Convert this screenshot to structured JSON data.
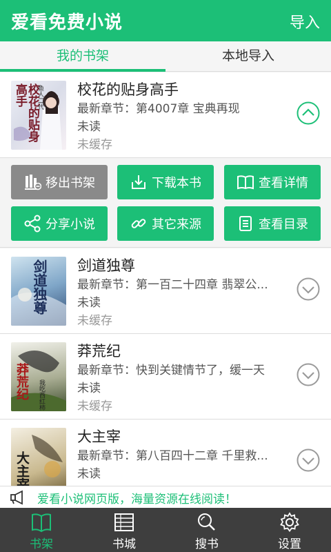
{
  "header": {
    "title": "爱看免费小说",
    "action_label": "导入"
  },
  "tabs": [
    {
      "label": "我的书架",
      "active": true
    },
    {
      "label": "本地导入",
      "active": false
    }
  ],
  "books": [
    {
      "title": "校花的贴身高手",
      "latest": "最新章节：第4007章 宝典再现",
      "read_status": "未读",
      "cache_status": "未缓存",
      "expanded": true,
      "cover_text": "校花的贴身高手",
      "cover_author": "鱼人二代"
    },
    {
      "title": "剑道独尊",
      "latest": "最新章节：第一百二十四章 翡翠公...",
      "read_status": "未读",
      "cache_status": "未缓存",
      "expanded": false,
      "cover_text": "剑道独尊"
    },
    {
      "title": "莽荒纪",
      "latest": "最新章节：快到关键情节了，缓一天",
      "read_status": "未读",
      "cache_status": "未缓存",
      "expanded": false,
      "cover_text": "莽荒纪",
      "cover_author": "我吃西红柿"
    },
    {
      "title": "大主宰",
      "latest": "最新章节：第八百四十二章 千里救...",
      "read_status": "未读",
      "cache_status": "",
      "expanded": false,
      "cover_text": "大主宰"
    }
  ],
  "actions": [
    {
      "label": "移出书架",
      "icon": "remove-books-icon",
      "style": "gray"
    },
    {
      "label": "下载本书",
      "icon": "download-icon",
      "style": "green"
    },
    {
      "label": "查看详情",
      "icon": "open-book-icon",
      "style": "green"
    },
    {
      "label": "分享小说",
      "icon": "share-icon",
      "style": "green"
    },
    {
      "label": "其它来源",
      "icon": "link-icon",
      "style": "green"
    },
    {
      "label": "查看目录",
      "icon": "list-icon",
      "style": "green"
    }
  ],
  "promo": {
    "text": "爱看小说网页版，海量资源在线阅读！",
    "icon": "megaphone-icon"
  },
  "bottom_nav": [
    {
      "label": "书架",
      "icon": "bookshelf-icon",
      "active": true
    },
    {
      "label": "书城",
      "icon": "bookstore-icon",
      "active": false
    },
    {
      "label": "搜书",
      "icon": "search-icon",
      "active": false
    },
    {
      "label": "设置",
      "icon": "gear-icon",
      "active": false
    }
  ],
  "colors": {
    "accent": "#1cbf77",
    "gray_button": "#8a8a8a",
    "nav_bg": "#3e3e3e"
  }
}
